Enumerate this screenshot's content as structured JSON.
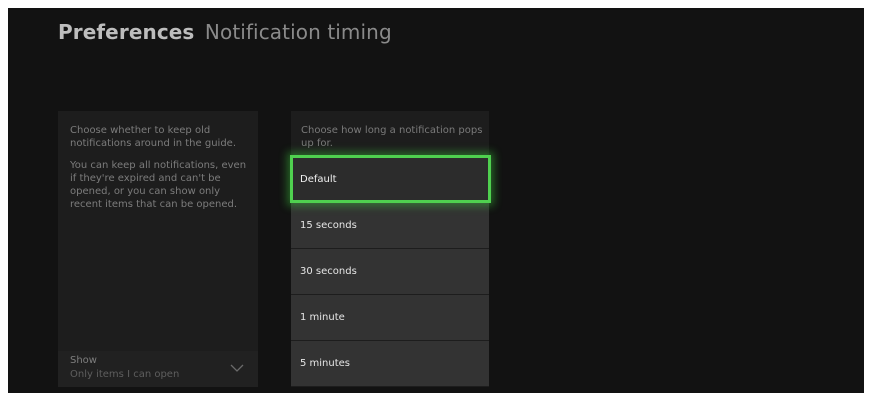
{
  "header": {
    "title": "Preferences",
    "subtitle": "Notification timing"
  },
  "left_panel": {
    "description_1": "Choose whether to keep old notifications around in the guide.",
    "description_2": "You can keep all notifications, even if they're expired and can't be opened, or you can show only recent items that can be opened.",
    "show_select": {
      "label": "Show",
      "value": "Only items I can open"
    }
  },
  "right_panel": {
    "description": "Choose how long a notification pops up for.",
    "options": [
      {
        "label": "Default",
        "focused": true
      },
      {
        "label": "15 seconds",
        "focused": false
      },
      {
        "label": "30 seconds",
        "focused": false
      },
      {
        "label": "1 minute",
        "focused": false
      },
      {
        "label": "5 minutes",
        "focused": false
      }
    ]
  },
  "colors": {
    "focus_accent": "#4fd04f",
    "background": "#121212",
    "panel": "#1d1d1d",
    "option": "#333333"
  }
}
